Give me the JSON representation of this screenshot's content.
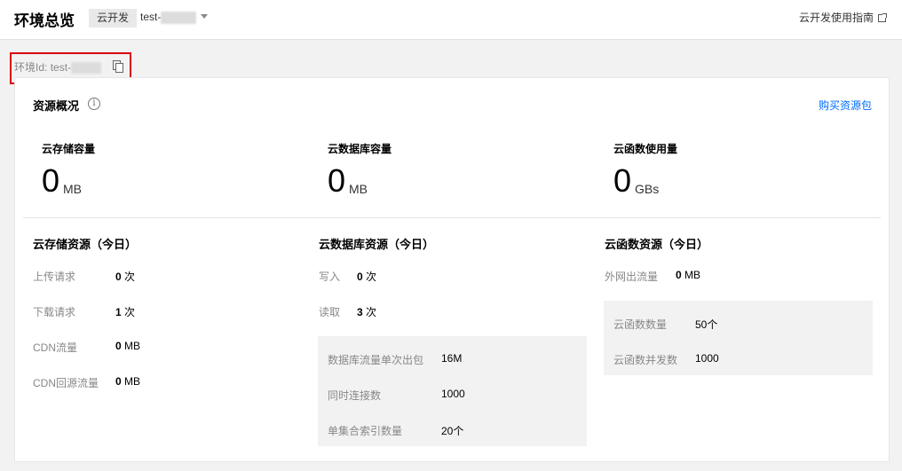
{
  "header": {
    "title": "环境总览",
    "env_tag": "云开发",
    "env_name": "test-",
    "guide_link": "云开发使用指南"
  },
  "env_id": {
    "label": "环境Id:",
    "value": "test-"
  },
  "overview": {
    "title": "资源概况",
    "info_icon": "i",
    "buy_link": "购买资源包",
    "metrics": [
      {
        "label": "云存储容量",
        "value": "0",
        "unit": "MB"
      },
      {
        "label": "云数据库容量",
        "value": "0",
        "unit": "MB"
      },
      {
        "label": "云函数使用量",
        "value": "0",
        "unit": "GBs"
      }
    ]
  },
  "storage": {
    "title": "云存储资源（今日）",
    "rows": [
      {
        "label": "上传请求",
        "value": "0",
        "unit": "次"
      },
      {
        "label": "下载请求",
        "value": "1",
        "unit": "次"
      },
      {
        "label": "CDN流量",
        "value": "0",
        "unit": "MB"
      },
      {
        "label": "CDN回源流量",
        "value": "0",
        "unit": "MB"
      }
    ]
  },
  "database": {
    "title": "云数据库资源（今日）",
    "rows": [
      {
        "label": "写入",
        "value": "0",
        "unit": "次"
      },
      {
        "label": "读取",
        "value": "3",
        "unit": "次"
      }
    ],
    "limits": [
      {
        "label": "数据库流量单次出包",
        "value": "16M"
      },
      {
        "label": "同时连接数",
        "value": "1000"
      },
      {
        "label": "单集合索引数量",
        "value": "20个"
      }
    ]
  },
  "functions": {
    "title": "云函数资源（今日）",
    "rows": [
      {
        "label": "外网出流量",
        "value": "0",
        "unit": "MB"
      }
    ],
    "limits": [
      {
        "label": "云函数数量",
        "value": "50个"
      },
      {
        "label": "云函数并发数",
        "value": "1000"
      }
    ]
  },
  "colors": {
    "link": "#006eff",
    "highlight_border": "#d8000f"
  }
}
